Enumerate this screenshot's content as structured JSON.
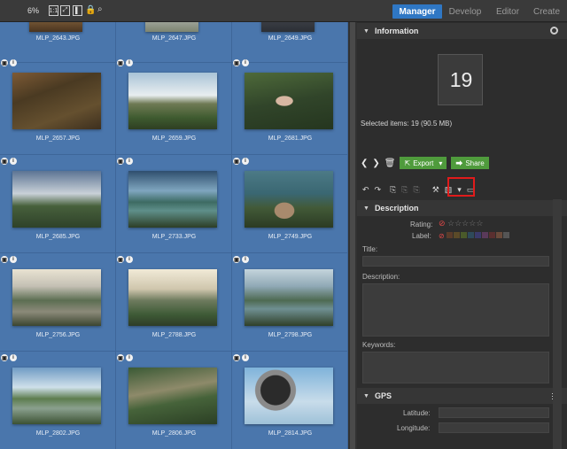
{
  "topbar": {
    "zoom": "6%",
    "icons": [
      "fit-icon",
      "fullscreen-icon",
      "film-icon",
      "lock-icon",
      "user-search-icon"
    ],
    "tabs": [
      {
        "label": "Manager",
        "active": true
      },
      {
        "label": "Develop",
        "active": false
      },
      {
        "label": "Editor",
        "active": false
      },
      {
        "label": "Create",
        "active": false
      }
    ]
  },
  "grid": {
    "rows": [
      [
        "MLP_2643.JPG",
        "MLP_2647.JPG",
        "MLP_2649.JPG"
      ],
      [
        "MLP_2657.JPG",
        "MLP_2659.JPG",
        "MLP_2681.JPG"
      ],
      [
        "MLP_2685.JPG",
        "MLP_2733.JPG",
        "MLP_2749.JPG"
      ],
      [
        "MLP_2756.JPG",
        "MLP_2788.JPG",
        "MLP_2798.JPG"
      ],
      [
        "MLP_2802.JPG",
        "MLP_2806.JPG",
        "MLP_2814.JPG"
      ]
    ],
    "badge_camera": "▣",
    "badge_info": "i",
    "colors": {
      "background": "#4a76ac",
      "grid_line": "#3e6699"
    }
  },
  "panel": {
    "information_title": "Information",
    "stack_count": "19",
    "selected_text": "Selected items: 19 (90.5 MB)",
    "export_label": "Export",
    "share_label": "Share",
    "description_title": "Description",
    "rating_label": "Rating:",
    "label_label": "Label:",
    "title_label": "Title:",
    "description_label": "Description:",
    "keywords_label": "Keywords:",
    "gps_title": "GPS",
    "latitude_label": "Latitude:",
    "longitude_label": "Longitude:",
    "label_colors": [
      "#5a3b2a",
      "#5b4a28",
      "#4a5a2a",
      "#2e4a5a",
      "#3a3a6a",
      "#5a3a5a",
      "#5a2f2f",
      "#6a4a3a",
      "#555555"
    ],
    "accent": "#2f77c4",
    "green": "#4f9b3c",
    "highlight": "#e01b1b"
  }
}
